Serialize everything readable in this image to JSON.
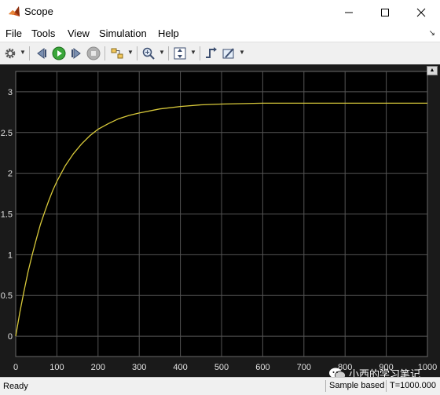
{
  "window": {
    "title": "Scope",
    "icon": "matlab-logo-icon"
  },
  "menu": {
    "items": [
      "File",
      "Tools",
      "View",
      "Simulation",
      "Help"
    ]
  },
  "toolbar": {
    "icons": [
      "settings-gear-icon",
      "step-back-icon",
      "run-icon",
      "step-forward-icon",
      "stop-icon",
      "highlight-simulink-block-icon",
      "zoom-icon",
      "scale-axes-icon",
      "triggers-icon",
      "style-icon"
    ]
  },
  "colors": {
    "plot_background": "#000000",
    "frame_background": "#1a1a1a",
    "grid": "#555555",
    "signal": "#d8c93a",
    "tick_label": "#e0e0e0"
  },
  "chart_data": {
    "type": "line",
    "xlim": [
      0,
      1000
    ],
    "ylim": [
      -0.25,
      3.25
    ],
    "x_ticks": [
      0,
      100,
      200,
      300,
      400,
      500,
      600,
      700,
      800,
      900,
      1000
    ],
    "y_ticks": [
      0,
      0.5,
      1,
      1.5,
      2,
      2.5,
      3
    ],
    "x_tick_labels": [
      "0",
      "100",
      "200",
      "300",
      "400",
      "500",
      "600",
      "700",
      "800",
      "900",
      "1000"
    ],
    "y_tick_labels": [
      "0",
      "0.5",
      "1",
      "1.5",
      "2",
      "2.5",
      "3"
    ],
    "grid": true,
    "series": [
      {
        "x": [
          0,
          10,
          20,
          30,
          40,
          50,
          60,
          70,
          80,
          90,
          100,
          120,
          140,
          160,
          180,
          200,
          225,
          250,
          275,
          300,
          350,
          400,
          450,
          500,
          600,
          700,
          800,
          900,
          1000
        ],
        "y": [
          0,
          0.29,
          0.55,
          0.79,
          1.0,
          1.19,
          1.37,
          1.52,
          1.66,
          1.79,
          1.9,
          2.09,
          2.24,
          2.36,
          2.46,
          2.54,
          2.61,
          2.67,
          2.71,
          2.74,
          2.79,
          2.82,
          2.84,
          2.85,
          2.86,
          2.86,
          2.86,
          2.86,
          2.86
        ]
      }
    ]
  },
  "status": {
    "ready": "Ready",
    "sample_mode": "Sample based",
    "time": "T=1000.000"
  },
  "watermark": {
    "text": "小西的学习笔记"
  }
}
